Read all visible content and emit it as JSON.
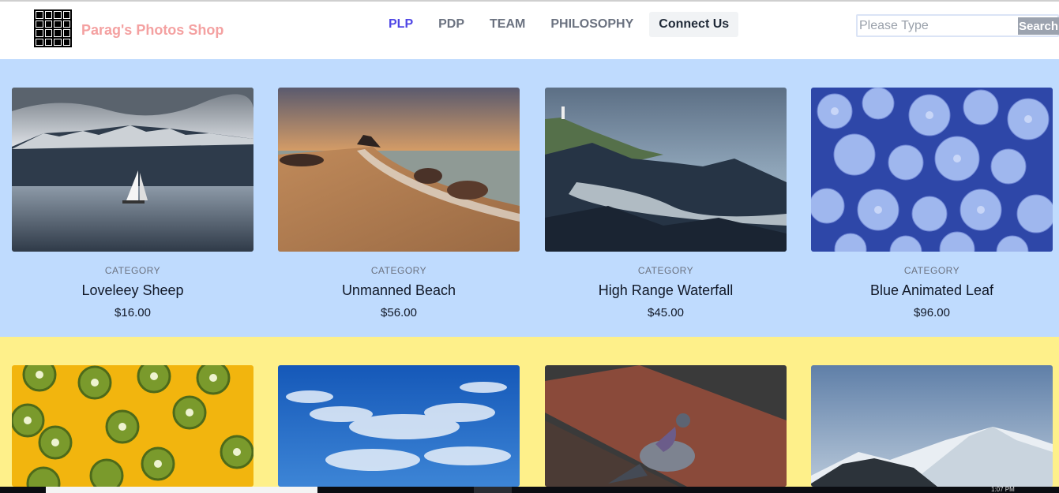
{
  "header": {
    "brand": "Parag's Photos Shop",
    "nav": [
      {
        "label": "PLP",
        "active": true
      },
      {
        "label": "PDP",
        "active": false
      },
      {
        "label": "TEAM",
        "active": false
      },
      {
        "label": "PHILOSOPHY",
        "active": false
      },
      {
        "label": "Connect Us",
        "active": false
      }
    ],
    "search": {
      "placeholder": "Please Type",
      "value": "",
      "button_label": "Search"
    }
  },
  "products": [
    {
      "category": "CATEGORY",
      "name": "Loveleey Sheep",
      "price": "$16.00"
    },
    {
      "category": "CATEGORY",
      "name": "Unmanned Beach",
      "price": "$56.00"
    },
    {
      "category": "CATEGORY",
      "name": "High Range Waterfall",
      "price": "$45.00"
    },
    {
      "category": "CATEGORY",
      "name": "Blue Animated Leaf",
      "price": "$96.00"
    }
  ],
  "colors": {
    "brand": "#f4a1a1",
    "nav_active": "#4f46e5",
    "row1_background": "#bfdbfe",
    "row2_background": "#fef08a"
  },
  "taskbar": {
    "time": "1:07 PM"
  }
}
